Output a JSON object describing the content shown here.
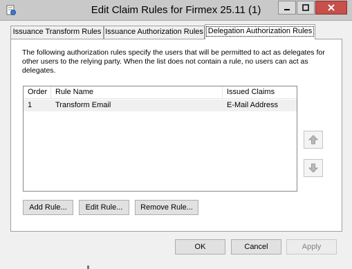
{
  "window": {
    "title": "Edit Claim Rules for Firmex 25.11 (1)",
    "controls": [
      "minimize",
      "maximize",
      "close"
    ]
  },
  "tabs": [
    {
      "label": "Issuance Transform Rules",
      "selected": false
    },
    {
      "label": "Issuance Authorization Rules",
      "selected": false
    },
    {
      "label": "Delegation Authorization Rules",
      "selected": true
    }
  ],
  "description": "The following authorization rules specify the users that will be permitted to act as delegates for other users to the relying party. When the list does not contain a rule, no users can act as delegates.",
  "rules_table": {
    "columns": [
      "Order",
      "Rule Name",
      "Issued Claims"
    ],
    "rows": [
      {
        "order": "1",
        "rule_name": "Transform Email",
        "issued_claims": "E-Mail Address"
      }
    ]
  },
  "rule_buttons": {
    "add": "Add Rule...",
    "edit": "Edit Rule...",
    "remove": "Remove Rule..."
  },
  "dialog_buttons": {
    "ok": "OK",
    "cancel": "Cancel",
    "apply": "Apply"
  },
  "icons": {
    "app": "claim-rules-icon",
    "move_up": "arrow-up-icon",
    "move_down": "arrow-down-icon"
  },
  "colors": {
    "titlebar": "#c9c9c9",
    "close_button": "#c7504a",
    "dialog_bg": "#f0f0f0",
    "panel_bg": "#ffffff",
    "disabled_text": "#838383"
  }
}
